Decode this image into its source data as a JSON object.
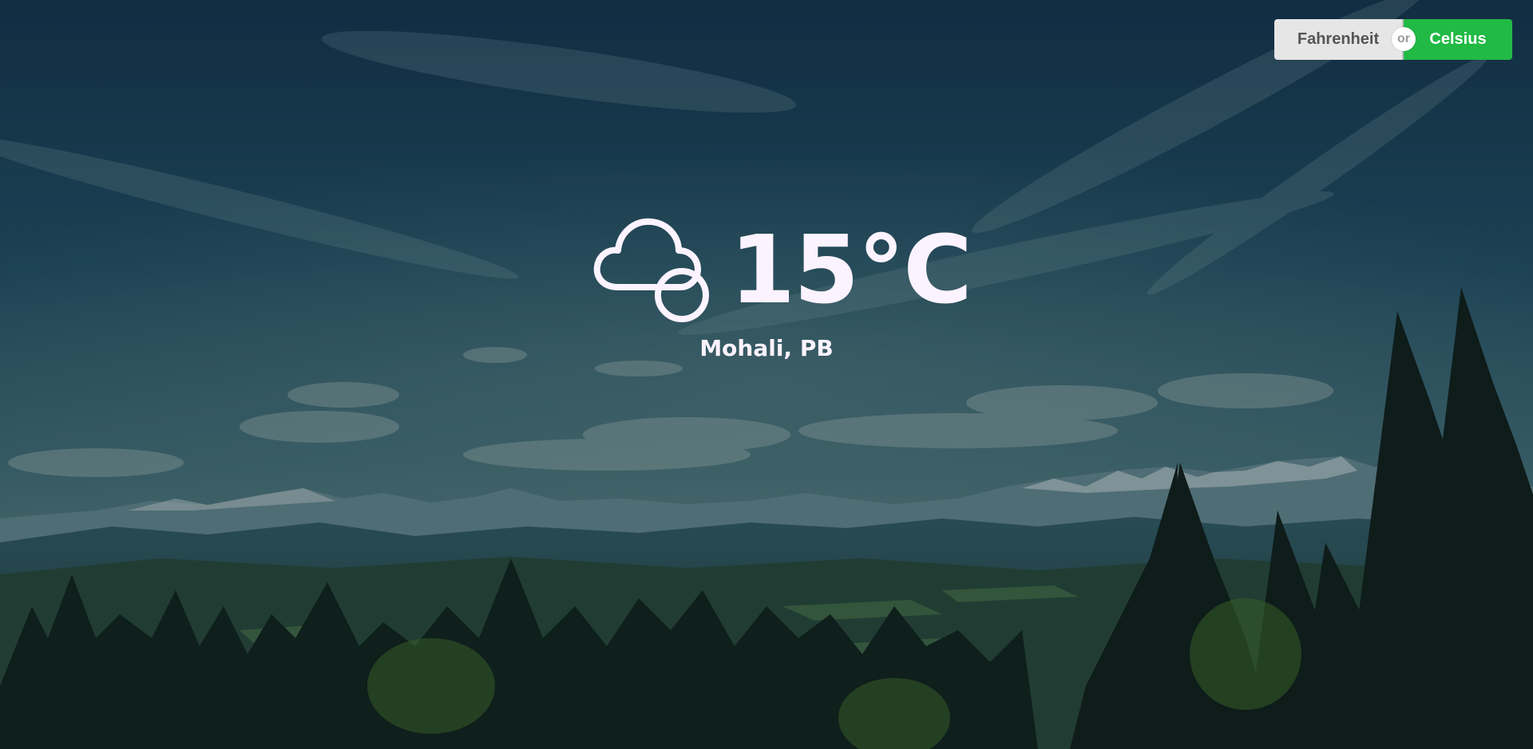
{
  "units": {
    "fahrenheit_label": "Fahrenheit",
    "separator_label": "or",
    "celsius_label": "Celsius",
    "selected": "Celsius"
  },
  "weather": {
    "icon": "partly-cloudy-icon",
    "temperature": "15°C",
    "location": "Mohali, PB"
  },
  "colors": {
    "celsius_active": "#21ba45",
    "fahrenheit_inactive": "#e6e6e6",
    "text": "#fbf3ff"
  }
}
